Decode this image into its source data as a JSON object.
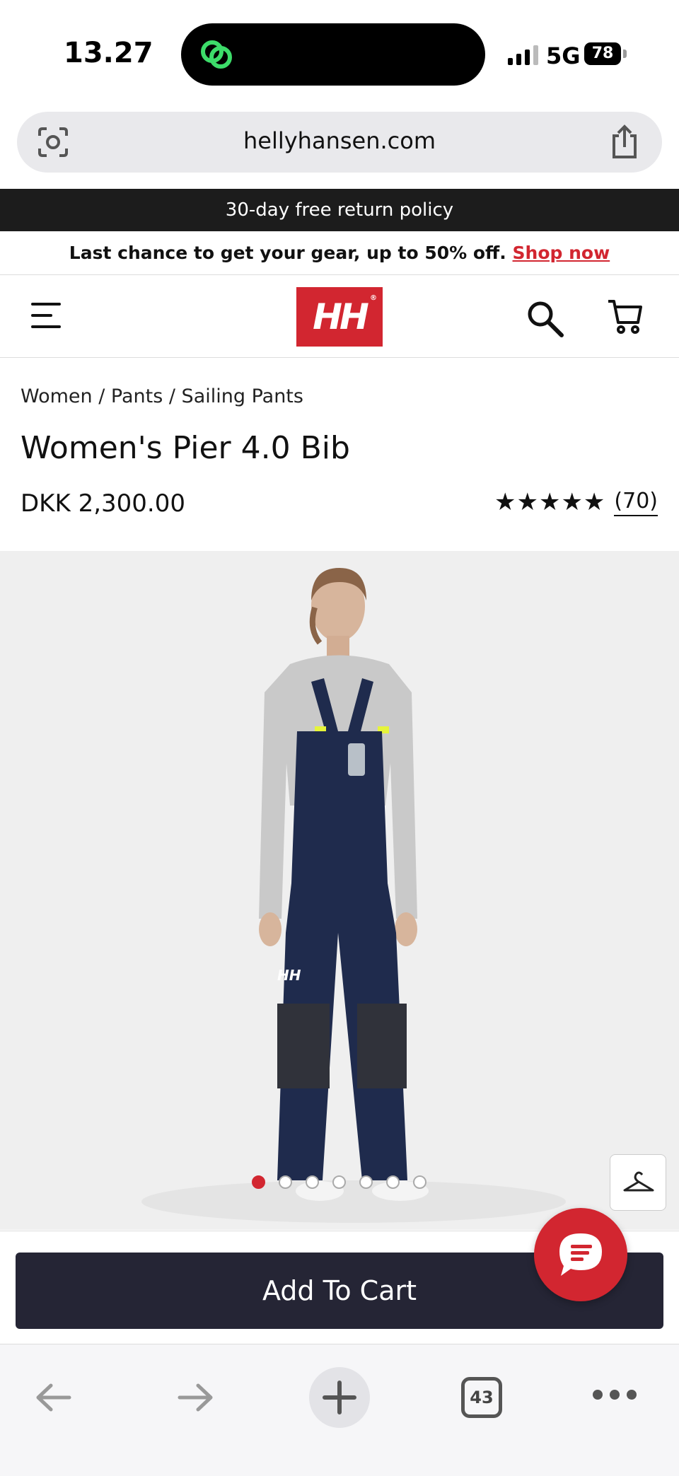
{
  "status_bar": {
    "time": "13.27",
    "network": "5G",
    "battery": "78"
  },
  "browser": {
    "url": "hellyhansen.com",
    "tabs_count": "43"
  },
  "promos": {
    "top": "30-day free return policy",
    "sale_text": "Last chance to get your gear, up to 50% off.",
    "sale_link": "Shop now"
  },
  "header": {
    "logo_text": "HH",
    "logo_mark": "®"
  },
  "product": {
    "breadcrumb": "Women / Pants / Sailing Pants",
    "title": "Women's Pier 4.0 Bib",
    "price": "DKK 2,300.00",
    "stars": "★★★★★",
    "rating_value": 5,
    "reviews": "(70)"
  },
  "gallery": {
    "image_count": 7,
    "active_index": 0
  },
  "actions": {
    "add_to_cart": "Add To Cart"
  },
  "colors": {
    "brand_red": "#d22630",
    "button_dark": "#252535",
    "navy": "#1f2b4d"
  }
}
